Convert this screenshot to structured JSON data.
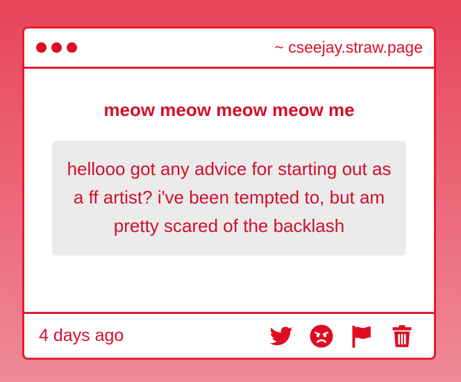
{
  "window": {
    "url": "~ cseejay.straw.page"
  },
  "post": {
    "title": "meow meow meow meow me",
    "message": "hellooo got any advice for starting out as a ff artist? i've been tempted to, but am pretty scared of the backlash"
  },
  "footer": {
    "time": "4 days ago",
    "actions": [
      "twitter-icon",
      "angry-face-icon",
      "flag-icon",
      "trash-icon"
    ]
  },
  "colors": {
    "accent": "#e51b2e",
    "background_top": "#e8445a",
    "background_bottom": "#ef8a96",
    "message_bg": "#ecebec"
  }
}
